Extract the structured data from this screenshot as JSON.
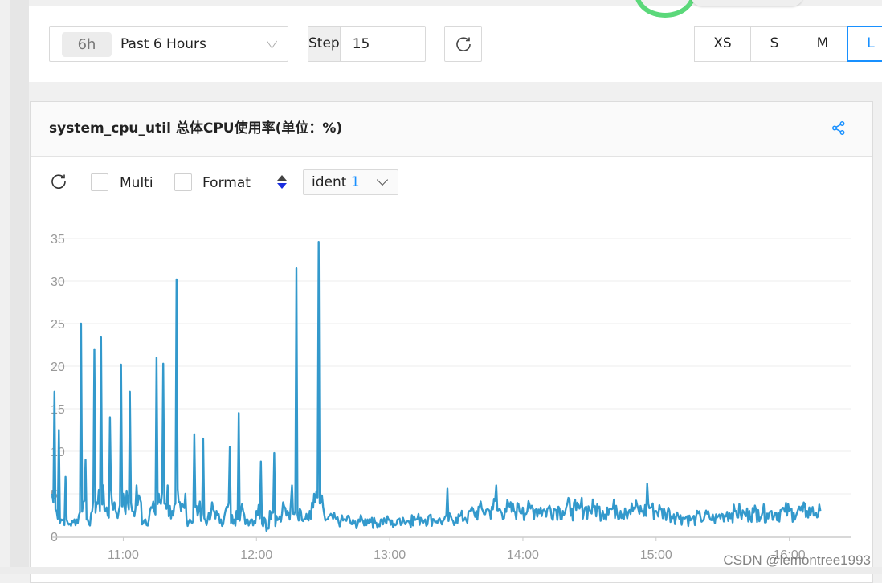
{
  "topbar": {
    "time_range": {
      "badge": "6h",
      "label": "Past 6 Hours"
    },
    "step": {
      "label": "Step",
      "value": "15"
    },
    "refresh_icon": "refresh-icon",
    "sizes": [
      {
        "label": "XS",
        "active": false
      },
      {
        "label": "S",
        "active": false
      },
      {
        "label": "M",
        "active": false
      },
      {
        "label": "L",
        "active": true
      }
    ]
  },
  "panel": {
    "title": "system_cpu_util 总体CPU使用率(单位：%)",
    "share_icon": "share-icon",
    "toolbar": {
      "refresh_icon": "refresh-icon",
      "multi_label": "Multi",
      "multi_checked": false,
      "format_label": "Format",
      "format_checked": false,
      "sort_icon": "sort-icon",
      "ident_label": "ident",
      "ident_count": "1"
    }
  },
  "colors": {
    "accent": "#1890ff",
    "series": "#3399cc",
    "grid": "#ececec"
  },
  "watermark": "CSDN @lemontree1993",
  "chart_data": {
    "type": "line",
    "title": "system_cpu_util 总体CPU使用率(单位：%)",
    "xlabel": "",
    "ylabel": "",
    "ylim": [
      0,
      37
    ],
    "yticks": [
      0,
      5,
      10,
      15,
      20,
      25,
      30,
      35
    ],
    "xlim": [
      "10:28",
      "16:28"
    ],
    "xticks": [
      "11:00",
      "12:00",
      "13:00",
      "14:00",
      "15:00",
      "16:00"
    ],
    "grid": true,
    "legend": "none",
    "series": [
      {
        "name": "system_cpu_util",
        "x_minutes_after_10_00": [
          28,
          29,
          30,
          31,
          32,
          34,
          36,
          38,
          40,
          41,
          42,
          43,
          44,
          46,
          47,
          48,
          50,
          51,
          52,
          54,
          56,
          58,
          59,
          60,
          62,
          63,
          64,
          66,
          68,
          70,
          72,
          74,
          75,
          76,
          78,
          80,
          82,
          84,
          85,
          86,
          88,
          90,
          92,
          94,
          96,
          98,
          100,
          102,
          104,
          106,
          108,
          110,
          111,
          112,
          114,
          116,
          118,
          120,
          122,
          124,
          125,
          126,
          128,
          130,
          132,
          134,
          136,
          138,
          140,
          142,
          144,
          146,
          148,
          149,
          150,
          152,
          154,
          156,
          158,
          160,
          162,
          164,
          166,
          168,
          170,
          172,
          174,
          176,
          178,
          180,
          182,
          184,
          186,
          188,
          190,
          192,
          194,
          196,
          198,
          200,
          202,
          204,
          206,
          208,
          210,
          212,
          214,
          216,
          218,
          220,
          222,
          224,
          225,
          226,
          228,
          230,
          232,
          234,
          236,
          238,
          240,
          242,
          244,
          246,
          248,
          250,
          252,
          254,
          256,
          258,
          260,
          262,
          264,
          266,
          268,
          270,
          272,
          274,
          276,
          278,
          280,
          282,
          284,
          286,
          288,
          290,
          292,
          294,
          296,
          298,
          300,
          302,
          304,
          306,
          308,
          310,
          311,
          312,
          314,
          316,
          318,
          320,
          322,
          324,
          326,
          328,
          330,
          332,
          334,
          336,
          338,
          340,
          342,
          344,
          346,
          348,
          350,
          352,
          354,
          356,
          358,
          360,
          362,
          364,
          366,
          368,
          370,
          372,
          374,
          376,
          378,
          380,
          382,
          384,
          386,
          388
        ],
        "values": [
          5,
          17,
          3,
          12.5,
          2,
          7,
          1.5,
          2,
          2.5,
          25,
          4,
          9,
          2,
          3,
          22,
          4,
          23.4,
          6,
          3,
          14,
          4,
          3,
          20.2,
          5,
          4,
          17,
          3,
          6,
          4,
          2,
          3,
          3,
          21,
          5,
          20.3,
          6,
          3,
          30.2,
          4,
          3,
          5,
          2,
          12,
          3,
          11.5,
          2,
          4,
          3,
          2,
          3,
          10.5,
          2,
          3,
          14.5,
          3,
          2,
          2,
          3,
          8.8,
          2,
          1,
          3,
          9.8,
          2,
          4,
          3,
          6,
          31.5,
          3,
          2,
          3,
          5,
          34.6,
          4,
          3.5,
          2,
          2.5,
          2,
          1.8,
          2,
          2,
          1.5,
          2,
          1.8,
          2,
          2.2,
          1.6,
          2,
          1.8,
          2,
          1.5,
          2,
          2.2,
          1.8,
          2.5,
          2,
          2.2,
          2,
          2.5,
          2,
          2,
          1.8,
          5.6,
          2,
          2.2,
          2.5,
          2.2,
          3,
          2.8,
          3.5,
          3,
          3.2,
          3,
          3.5,
          6,
          3,
          3.2,
          3.5,
          3,
          3.8,
          3.4,
          3,
          3.6,
          3.2,
          3.4,
          3,
          3.6,
          3.2,
          3.5,
          3,
          3.8,
          3.3,
          3.1,
          3.6,
          3.4,
          3.2,
          3.5,
          3.3,
          3,
          3.4,
          3.2,
          3.6,
          3,
          3.3,
          3.1,
          3.4,
          3.2,
          3,
          6.2,
          3.5,
          3,
          3.2,
          2.8,
          3,
          2.6,
          2.4,
          2.5,
          2.2,
          2.4,
          2,
          2.3,
          2.2,
          2.6,
          2.3,
          2.1,
          2.4,
          2.6,
          2.9,
          2.7,
          3,
          2.8,
          2.6,
          3,
          2.8,
          3.1,
          2.9,
          2.7,
          3,
          2.8,
          3.1,
          2.9,
          3,
          2.8,
          3.2,
          2.9,
          3,
          3.1,
          2.8,
          3
        ]
      }
    ]
  }
}
